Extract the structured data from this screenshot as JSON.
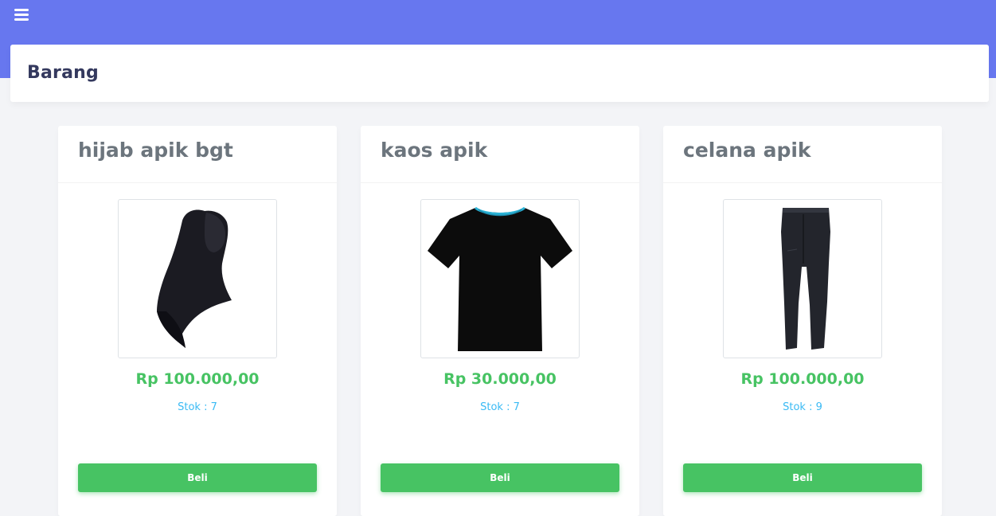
{
  "page": {
    "title": "Barang"
  },
  "colors": {
    "topbar": "#6777ef",
    "price": "#47c363",
    "stock": "#3abaf4",
    "button": "#47c363"
  },
  "products": [
    {
      "name": "hijab apik bgt",
      "price": "Rp 100.000,00",
      "stock": "Stok : 7",
      "button_label": "Beli",
      "image_icon": "hijab-image"
    },
    {
      "name": "kaos apik",
      "price": "Rp 30.000,00",
      "stock": "Stok : 7",
      "button_label": "Beli",
      "image_icon": "tshirt-image"
    },
    {
      "name": "celana apik",
      "price": "Rp 100.000,00",
      "stock": "Stok : 9",
      "button_label": "Beli",
      "image_icon": "pants-image"
    }
  ]
}
